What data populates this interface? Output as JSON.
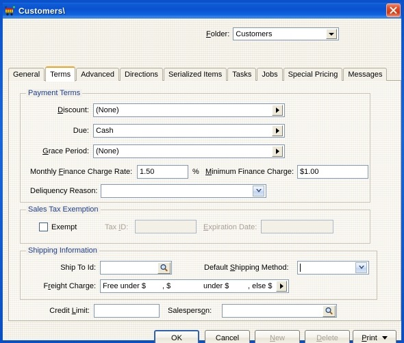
{
  "window": {
    "title": "Customers\\",
    "icon": "shopping-cart-icon",
    "close_label": "Close",
    "accent_titlebar": "#0a52cf",
    "accent_close": "#cf3a14",
    "accent_tab_selected": "#f0a422",
    "accent_group_caption": "#1b3f94"
  },
  "folder": {
    "label": "Folder:",
    "label_prefix": "F",
    "label_rest": "older:",
    "value": "Customers"
  },
  "tabs": [
    {
      "label": "General",
      "selected": false
    },
    {
      "label": "Terms",
      "selected": true
    },
    {
      "label": "Advanced",
      "selected": false
    },
    {
      "label": "Directions",
      "selected": false
    },
    {
      "label": "Serialized Items",
      "selected": false
    },
    {
      "label": "Tasks",
      "selected": false
    },
    {
      "label": "Jobs",
      "selected": false
    },
    {
      "label": "Special Pricing",
      "selected": false
    },
    {
      "label": "Messages",
      "selected": false
    }
  ],
  "payment_terms": {
    "caption": "Payment Terms",
    "discount": {
      "label_a": "D",
      "label_b": "iscount:",
      "value": "(None)"
    },
    "due": {
      "label_a": "Du",
      "label_b": "e:",
      "label_c": "",
      "value": "Cash"
    },
    "grace_period": {
      "label_a": "G",
      "label_b": "race Period:",
      "value": "(None)"
    },
    "monthly_rate": {
      "label_pre": "Monthly ",
      "label_key": "F",
      "label_post": "inance Charge Rate:",
      "value": "1.50",
      "suffix": "%"
    },
    "minimum_charge": {
      "label_key": "M",
      "label_post": "inimum Finance Charge:",
      "value": "$1.00"
    },
    "delinquency_reason": {
      "label": "Deliquency Reason:",
      "value": ""
    }
  },
  "sales_tax_exemption": {
    "caption": "Sales Tax Exemption",
    "exempt": {
      "label": "Exempt",
      "checked": false
    },
    "tax_id": {
      "label_pre": "Tax ",
      "label_key": "I",
      "label_post": "D:",
      "value": "",
      "disabled": true
    },
    "expiration_date": {
      "label_key": "E",
      "label_post": "xpiration Date:",
      "value": "",
      "disabled": true
    }
  },
  "shipping_information": {
    "caption": "Shipping Information",
    "ship_to_id": {
      "label": "Ship To Id:",
      "value": "",
      "icon": "magnifier-icon"
    },
    "default_shipping_method": {
      "label_pre": "Default ",
      "label_key": "S",
      "label_post": "hipping Method:",
      "value": ""
    },
    "freight_charge": {
      "label_pre": "F",
      "label_key": "r",
      "label_post": "eight Charge:",
      "parts": [
        "Free under $",
        ", $",
        "under $",
        ", else $"
      ]
    }
  },
  "credit": {
    "credit_limit": {
      "label_pre": "Credit ",
      "label_key": "L",
      "label_post": "imit:",
      "value": ""
    },
    "salesperson": {
      "label_pre": "Salespers",
      "label_key": "o",
      "label_post": "n:",
      "value": "",
      "icon": "magnifier-icon"
    }
  },
  "buttons": {
    "ok": {
      "label": "OK",
      "default": true,
      "disabled": false
    },
    "cancel": {
      "label": "Cancel",
      "default": false,
      "disabled": false
    },
    "new": {
      "label_key": "N",
      "label_post": "ew",
      "disabled": true
    },
    "delete": {
      "label_key": "D",
      "label_post": "elete",
      "disabled": true
    },
    "print": {
      "label_key": "P",
      "label_post": "rint",
      "disabled": false,
      "has_dropdown": true
    }
  }
}
